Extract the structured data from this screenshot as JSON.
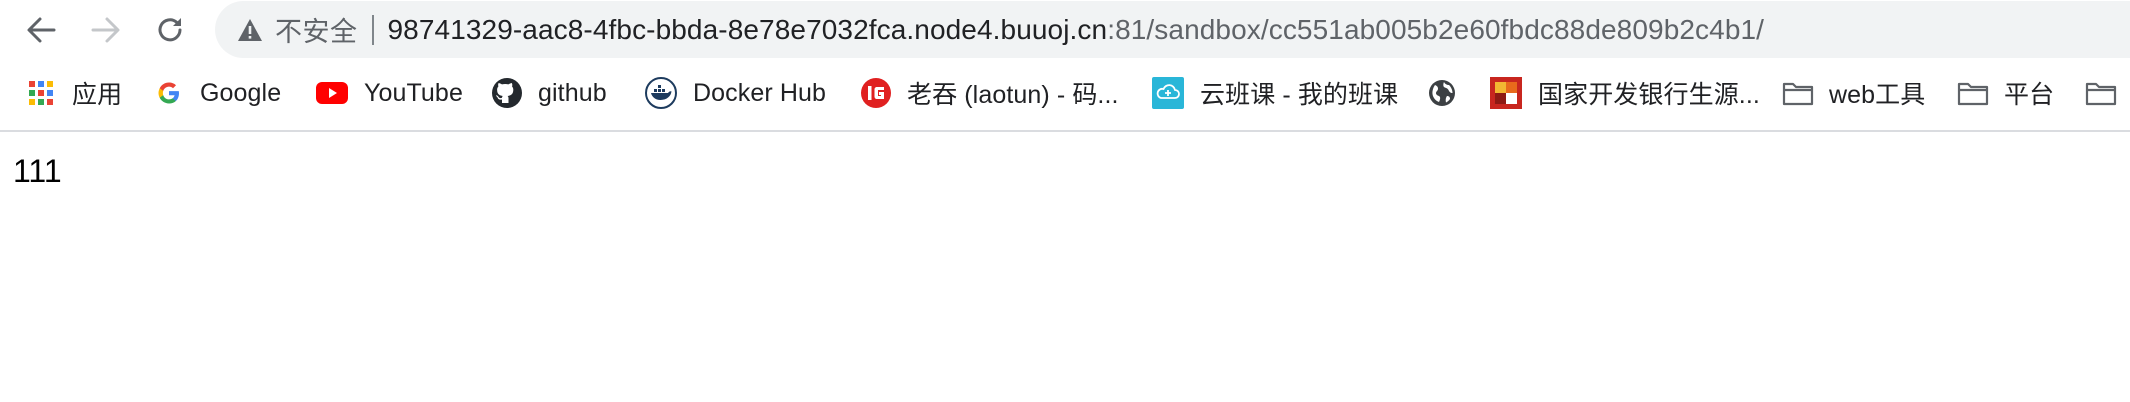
{
  "toolbar": {
    "back_icon": "arrow-left-icon",
    "forward_icon": "arrow-right-icon",
    "reload_icon": "reload-icon"
  },
  "omnibox": {
    "security_label": "不安全",
    "url_host": "98741329-aac8-4fbc-bbda-8e78e7032fca.node4.buuoj.cn",
    "url_rest": ":81/sandbox/cc551ab005b2e60fbdc88de809b2c4b1/"
  },
  "bookmarks": {
    "items": [
      {
        "label": "应用",
        "icon": "apps-grid-icon"
      },
      {
        "label": "Google",
        "icon": "google-icon"
      },
      {
        "label": "YouTube",
        "icon": "youtube-icon"
      },
      {
        "label": "github",
        "icon": "github-icon"
      },
      {
        "label": "Docker Hub",
        "icon": "docker-icon"
      },
      {
        "label": "老吞 (laotun) - 码...",
        "icon": "laotun-icon"
      },
      {
        "label": "云班课 - 我的班课",
        "icon": "cloud-class-icon"
      },
      {
        "label": "",
        "icon": "globe-icon"
      },
      {
        "label": "国家开发银行生源...",
        "icon": "cdb-icon"
      },
      {
        "label": "web工具",
        "icon": "folder-icon"
      },
      {
        "label": "平台",
        "icon": "folder-icon"
      },
      {
        "label": "",
        "icon": "folder-icon"
      }
    ]
  },
  "page": {
    "body_text": "111"
  },
  "colors": {
    "omnibox_bg": "#f1f3f4",
    "youtube_red": "#ff0000",
    "docker_navy": "#1d3b5e",
    "laotun_red": "#e02020",
    "cloud_cyan": "#29b6d8"
  }
}
